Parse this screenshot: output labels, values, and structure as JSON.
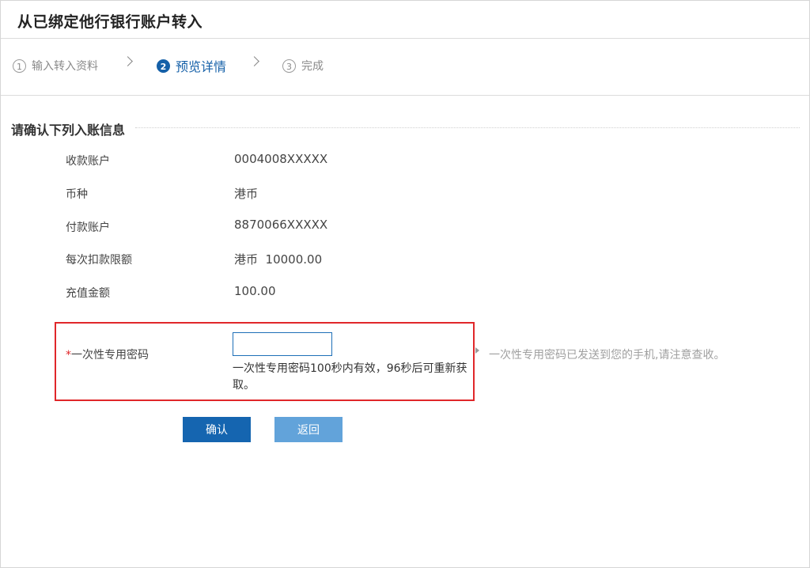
{
  "page": {
    "title": "从已绑定他行银行账户转入"
  },
  "steps": [
    {
      "num": "1",
      "label": "输入转入资料",
      "active": false
    },
    {
      "num": "2",
      "label": "预览详情",
      "active": true
    },
    {
      "num": "3",
      "label": "完成",
      "active": false
    }
  ],
  "section": {
    "heading": "请确认下列入账信息"
  },
  "details": [
    {
      "label": "收款账户",
      "value": "0004008XXXXX"
    },
    {
      "label": "币种",
      "value": "港币"
    },
    {
      "label": "付款账户",
      "value": "8870066XXXXX"
    },
    {
      "label": "每次扣款限额",
      "value": "港币  10000.00"
    },
    {
      "label": "充值金额",
      "value": "100.00"
    }
  ],
  "otp": {
    "required_mark": "*",
    "label": "一次性专用密码",
    "value": "",
    "note": "一次性专用密码100秒内有效，96秒后可重新获取。",
    "tip": "一次性专用密码已发送到您的手机,请注意查收。"
  },
  "buttons": {
    "confirm": "确认",
    "back": "返回"
  },
  "colors": {
    "primary": "#1565b0",
    "secondary": "#62a3da",
    "highlight_border": "#e0272a"
  }
}
